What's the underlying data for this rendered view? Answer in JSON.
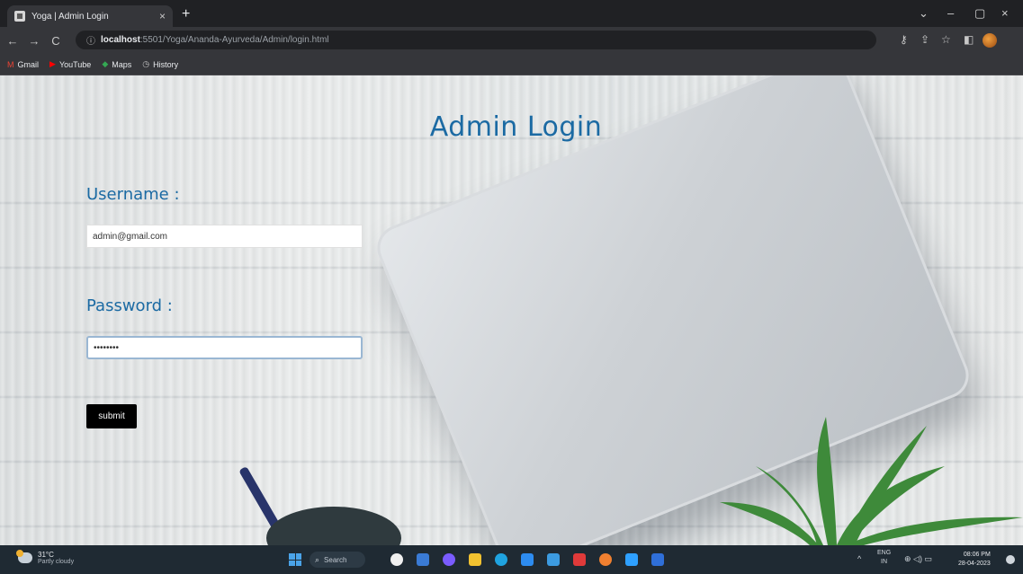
{
  "browser": {
    "tab_title": "Yoga | Admin Login",
    "tab_close": "×",
    "new_tab": "+",
    "window_controls": {
      "chevron": "⌄",
      "minimize": "–",
      "restore": "▢",
      "close": "×"
    },
    "nav": {
      "back": "←",
      "forward": "→",
      "reload": "C"
    },
    "address": {
      "info_icon": "ⓘ",
      "host": "localhost",
      "path": ":5501/Yoga/Ananda-Ayurveda/Admin/login.html"
    },
    "toolbar_icons": {
      "key": "⚷",
      "share": "⇪",
      "star": "☆",
      "extensions": "◧"
    },
    "bookmarks": [
      {
        "icon": "M",
        "color": "#ea4335",
        "label": "Gmail"
      },
      {
        "icon": "▶",
        "color": "#ff0000",
        "label": "YouTube"
      },
      {
        "icon": "◆",
        "color": "#34a853",
        "label": "Maps"
      },
      {
        "icon": "◷",
        "color": "#c8c8c8",
        "label": "History"
      }
    ]
  },
  "page": {
    "heading": "Admin Login",
    "username_label": "Username :",
    "username_value": "admin@gmail.com",
    "password_label": "Password :",
    "password_value": "admin123",
    "submit_label": "submit",
    "apple_logo": ""
  },
  "taskbar": {
    "weather_temp": "31°C",
    "weather_desc": "Partly cloudy",
    "search_label": "Search",
    "search_icon": "⌕",
    "apps": [
      {
        "name": "app-1",
        "color": "#f0f0f0"
      },
      {
        "name": "app-2",
        "color": "#3a7bd5"
      },
      {
        "name": "app-3",
        "color": "#7a5cff"
      },
      {
        "name": "app-4",
        "color": "#f2c230"
      },
      {
        "name": "app-5",
        "color": "#1fa3e0"
      },
      {
        "name": "app-6",
        "color": "#2d8cf0"
      },
      {
        "name": "app-7",
        "color": "#3c9be0"
      },
      {
        "name": "app-8",
        "color": "#e03a3a"
      },
      {
        "name": "app-9",
        "color": "#f08030"
      },
      {
        "name": "app-10",
        "color": "#2ea0ff"
      },
      {
        "name": "app-11",
        "color": "#2f6fd8"
      }
    ],
    "tray_chevron": "^",
    "lang_top": "ENG",
    "lang_bottom": "IN",
    "tray_icons": "⊕ ◁) ▭",
    "time": "08:06 PM",
    "date": "28-04-2023"
  },
  "colors": {
    "heading": "#1b6aa3",
    "button": "#000000",
    "taskbar": "#1f2a33",
    "chrome_dark": "#202124",
    "chrome_toolbar": "#35363a"
  }
}
